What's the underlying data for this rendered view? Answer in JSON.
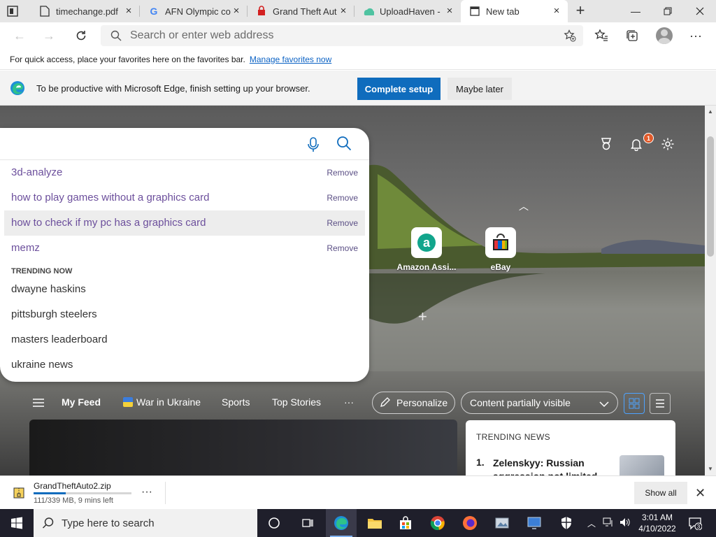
{
  "tabs": [
    {
      "label": "timechange.pdf",
      "icon": "pdf-icon"
    },
    {
      "label": "AFN Olympic co",
      "icon": "google-icon"
    },
    {
      "label": "Grand Theft Aut",
      "icon": "red-app-icon"
    },
    {
      "label": "UploadHaven - ",
      "icon": "uploadhaven-icon"
    },
    {
      "label": "New tab",
      "icon": "newtab-icon",
      "active": true
    }
  ],
  "address": {
    "placeholder": "Search or enter web address"
  },
  "favorites_bar": {
    "text": "For quick access, place your favorites here on the favorites bar.",
    "link": "Manage favorites now"
  },
  "infobar": {
    "message": "To be productive with Microsoft Edge, finish setting up your browser.",
    "primary": "Complete setup",
    "secondary": "Maybe later"
  },
  "search": {
    "history": [
      {
        "text": "3d-analyze",
        "remove": "Remove"
      },
      {
        "text": "how to play games without a graphics card",
        "remove": "Remove"
      },
      {
        "text": "how to check if my pc has a graphics card",
        "remove": "Remove"
      },
      {
        "text": "memz",
        "remove": "Remove"
      }
    ],
    "trending_header": "TRENDING NOW",
    "trending": [
      "dwayne haskins",
      "pittsburgh steelers",
      "masters leaderboard",
      "ukraine news"
    ]
  },
  "notifications": {
    "count": "1"
  },
  "quick_links": [
    {
      "label": "Amazon Assi...",
      "icon": "amazon-icon"
    },
    {
      "label": "eBay",
      "icon": "ebay-icon"
    }
  ],
  "feed": {
    "items": [
      "My Feed",
      "War in Ukraine",
      "Sports",
      "Top Stories"
    ],
    "more": "···",
    "personalize": "Personalize",
    "visibility": "Content partially visible"
  },
  "trending_news": {
    "header": "TRENDING NEWS",
    "item_number": "1.",
    "item_title": "Zelenskyy: Russian aggression not limited to"
  },
  "download": {
    "filename": "GrandTheftAuto2.zip",
    "status": "111/339 MB, 9 mins left",
    "progress": 0.33,
    "more": "···",
    "show_all": "Show all"
  },
  "taskbar": {
    "search_placeholder": "Type here to search",
    "time": "3:01 AM",
    "date": "4/10/2022",
    "notification_count": "3"
  },
  "colors": {
    "accent": "#0f6cbd",
    "badge": "#e05a2a",
    "taskbar": "#1f1f2b"
  }
}
